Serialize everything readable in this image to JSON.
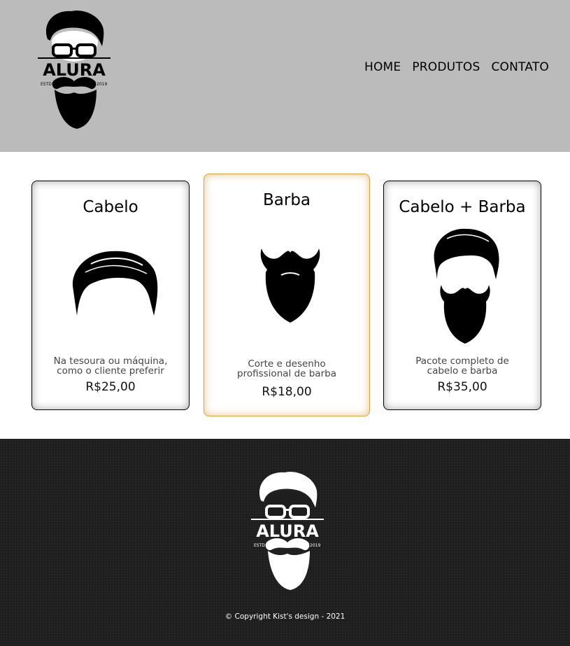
{
  "header": {
    "logo": {
      "text": "ALURA",
      "estd": "ESTD",
      "year": "2019"
    },
    "nav": [
      "HOME",
      "PRODUTOS",
      "CONTATO"
    ]
  },
  "cards": [
    {
      "title": "Cabelo",
      "icon": "hair-icon",
      "desc_line1": "Na tesoura ou máquina,",
      "desc_line2": "como o cliente preferir",
      "price": "R$25,00"
    },
    {
      "title": "Barba",
      "icon": "beard-icon",
      "desc_line1": "Corte e desenho",
      "desc_line2": "profissional de barba",
      "price": "R$18,00"
    },
    {
      "title": "Cabelo + Barba",
      "icon": "hair-and-beard-icon",
      "desc_line1": "Pacote completo de",
      "desc_line2": "cabelo e barba",
      "price": "R$35,00"
    }
  ],
  "footer": {
    "logo": {
      "text": "ALURA",
      "estd": "ESTD",
      "year": "2019"
    },
    "copyright": "© Copyright Kist's design - 2021"
  },
  "colors": {
    "header_bg": "#bbbbbb",
    "footer_bg": "#1e1e1e",
    "featured_border": "#d9a23a"
  }
}
